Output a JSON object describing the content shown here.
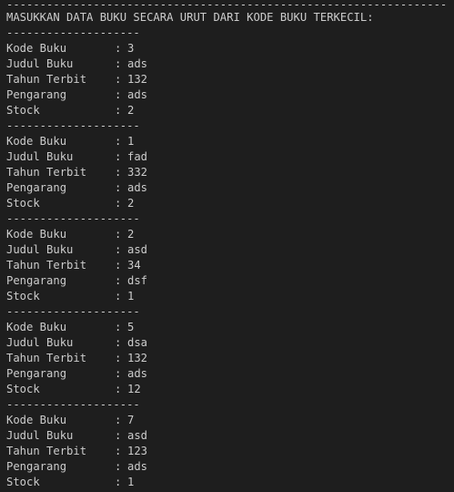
{
  "terminal": {
    "top_separator": "------------------------------------------------------------------",
    "heading": "MASUKKAN DATA BUKU SECARA URUT DARI KODE BUKU TERKECIL:",
    "record_separator": "--------------------",
    "colon": ":",
    "labels": {
      "kode": "Kode Buku",
      "judul": "Judul Buku",
      "tahun": "Tahun Terbit",
      "pengarang": "Pengarang",
      "stock": "Stock"
    },
    "records": [
      {
        "kode": "3",
        "judul": "ads",
        "tahun": "132",
        "pengarang": "ads",
        "stock": "2"
      },
      {
        "kode": "1",
        "judul": "fad",
        "tahun": "332",
        "pengarang": "ads",
        "stock": "2"
      },
      {
        "kode": "2",
        "judul": "asd",
        "tahun": "34",
        "pengarang": "dsf",
        "stock": "1"
      },
      {
        "kode": "5",
        "judul": "dsa",
        "tahun": "132",
        "pengarang": "ads",
        "stock": "12"
      },
      {
        "kode": "7",
        "judul": "asd",
        "tahun": "123",
        "pengarang": "ads",
        "stock": "1"
      }
    ]
  }
}
